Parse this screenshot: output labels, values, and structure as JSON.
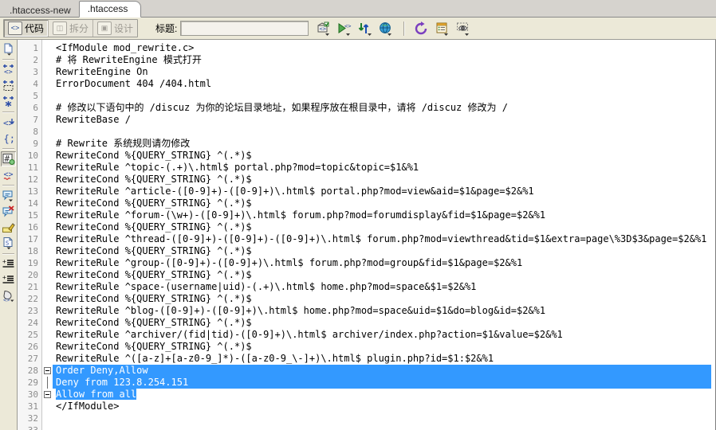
{
  "window": {
    "tabs": [
      {
        "label": ".htaccess-new",
        "active": false
      },
      {
        "label": ".htaccess",
        "active": true
      }
    ]
  },
  "toolbar": {
    "view_buttons": [
      {
        "label": "代码",
        "icon": "code-icon",
        "state": "active"
      },
      {
        "label": "拆分",
        "icon": "split-icon",
        "state": "disabled"
      },
      {
        "label": "设计",
        "icon": "design-icon",
        "state": "disabled"
      }
    ],
    "title_label": "标题:",
    "title_value": "",
    "title_placeholder": "",
    "icons": [
      {
        "name": "file-management-icon"
      },
      {
        "name": "preview-in-browser-icon"
      },
      {
        "name": "file-transfer-icon"
      },
      {
        "name": "visual-aids-globe-icon"
      },
      {
        "name": "refresh-design-view-icon"
      },
      {
        "name": "view-options-icon"
      },
      {
        "name": "live-view-icon"
      }
    ]
  },
  "rail": {
    "items": [
      {
        "name": "common-insert-icon"
      },
      {
        "name": "quick-tag-edit-icon"
      },
      {
        "name": "selection-wrap-icon"
      },
      {
        "name": "collapse-selection-icon"
      },
      {
        "name": "expand-all-icon"
      },
      {
        "name": "balance-braces-icon"
      },
      {
        "name": "line-numbers-icon",
        "selected": true
      },
      {
        "name": "highlight-invalid-code-icon"
      },
      {
        "name": "apply-comment-icon"
      },
      {
        "name": "remove-comment-icon"
      },
      {
        "name": "wrap-tag-icon"
      },
      {
        "name": "recent-snippets-icon"
      },
      {
        "name": "indent-code-icon"
      },
      {
        "name": "outdent-code-icon"
      },
      {
        "name": "format-source-code-icon"
      }
    ]
  },
  "editor": {
    "selection_color": "#3399ff",
    "selection_text_color": "#ffffff",
    "fold_lines": [
      28,
      30
    ],
    "fold_stem_lines": [
      29
    ],
    "lines": [
      {
        "n": 1,
        "text": "<IfModule mod_rewrite.c>"
      },
      {
        "n": 2,
        "text": "# 将 RewriteEngine 模式打开"
      },
      {
        "n": 3,
        "text": "RewriteEngine On"
      },
      {
        "n": 4,
        "text": "ErrorDocument 404 /404.html"
      },
      {
        "n": 5,
        "text": ""
      },
      {
        "n": 6,
        "text": "# 修改以下语句中的 /discuz 为你的论坛目录地址，如果程序放在根目录中，请将 /discuz 修改为 /"
      },
      {
        "n": 7,
        "text": "RewriteBase /"
      },
      {
        "n": 8,
        "text": ""
      },
      {
        "n": 9,
        "text": "# Rewrite 系统规则请勿修改"
      },
      {
        "n": 10,
        "text": "RewriteCond %{QUERY_STRING} ^(.*)$"
      },
      {
        "n": 11,
        "text": "RewriteRule ^topic-(.+)\\.html$ portal.php?mod=topic&topic=$1&%1"
      },
      {
        "n": 12,
        "text": "RewriteCond %{QUERY_STRING} ^(.*)$"
      },
      {
        "n": 13,
        "text": "RewriteRule ^article-([0-9]+)-([0-9]+)\\.html$ portal.php?mod=view&aid=$1&page=$2&%1"
      },
      {
        "n": 14,
        "text": "RewriteCond %{QUERY_STRING} ^(.*)$"
      },
      {
        "n": 15,
        "text": "RewriteRule ^forum-(\\w+)-([0-9]+)\\.html$ forum.php?mod=forumdisplay&fid=$1&page=$2&%1"
      },
      {
        "n": 16,
        "text": "RewriteCond %{QUERY_STRING} ^(.*)$"
      },
      {
        "n": 17,
        "text": "RewriteRule ^thread-([0-9]+)-([0-9]+)-([0-9]+)\\.html$ forum.php?mod=viewthread&tid=$1&extra=page\\%3D$3&page=$2&%1"
      },
      {
        "n": 18,
        "text": "RewriteCond %{QUERY_STRING} ^(.*)$"
      },
      {
        "n": 19,
        "text": "RewriteRule ^group-([0-9]+)-([0-9]+)\\.html$ forum.php?mod=group&fid=$1&page=$2&%1"
      },
      {
        "n": 20,
        "text": "RewriteCond %{QUERY_STRING} ^(.*)$"
      },
      {
        "n": 21,
        "text": "RewriteRule ^space-(username|uid)-(.+)\\.html$ home.php?mod=space&$1=$2&%1"
      },
      {
        "n": 22,
        "text": "RewriteCond %{QUERY_STRING} ^(.*)$"
      },
      {
        "n": 23,
        "text": "RewriteRule ^blog-([0-9]+)-([0-9]+)\\.html$ home.php?mod=space&uid=$1&do=blog&id=$2&%1"
      },
      {
        "n": 24,
        "text": "RewriteCond %{QUERY_STRING} ^(.*)$"
      },
      {
        "n": 25,
        "text": "RewriteRule ^archiver/(fid|tid)-([0-9]+)\\.html$ archiver/index.php?action=$1&value=$2&%1"
      },
      {
        "n": 26,
        "text": "RewriteCond %{QUERY_STRING} ^(.*)$"
      },
      {
        "n": 27,
        "text": "RewriteRule ^([a-z]+[a-z0-9_]*)-([a-z0-9_\\-]+)\\.html$ plugin.php?id=$1:$2&%1"
      },
      {
        "n": 28,
        "text": "Order Deny,Allow",
        "selected": "full"
      },
      {
        "n": 29,
        "text": "Deny from 123.8.254.151",
        "selected": "full"
      },
      {
        "n": 30,
        "text": "Allow from all",
        "selected": "text"
      },
      {
        "n": 31,
        "text": "</IfModule>"
      },
      {
        "n": 32,
        "text": ""
      }
    ]
  }
}
